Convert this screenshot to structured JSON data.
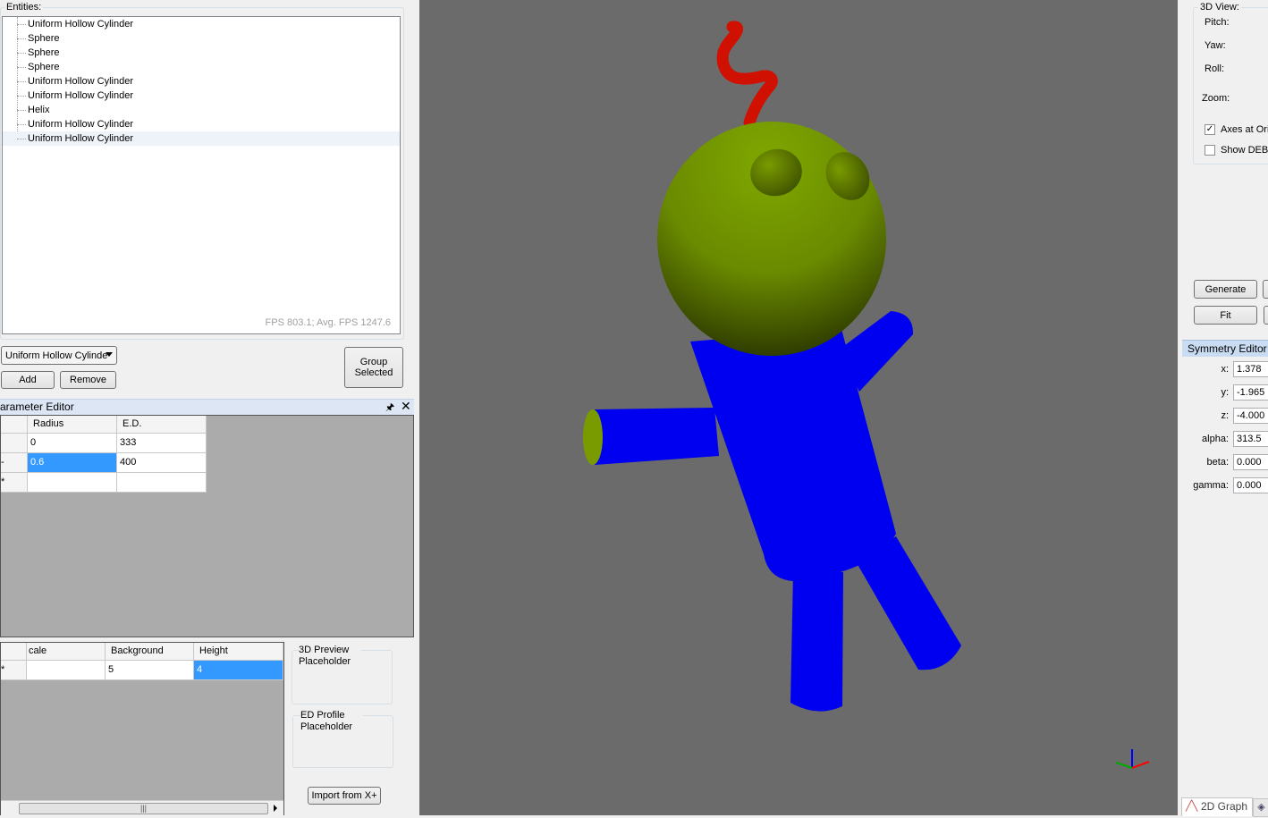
{
  "entities": {
    "label": "Entities:",
    "items": [
      "Uniform Hollow Cylinder",
      "Sphere",
      "Sphere",
      "Sphere",
      "Uniform Hollow Cylinder",
      "Uniform Hollow Cylinder",
      "Helix",
      "Uniform Hollow Cylinder",
      "Uniform Hollow Cylinder"
    ],
    "fps": "FPS 803.1; Avg. FPS 1247.6"
  },
  "toolbar": {
    "type_dropdown": "Uniform Hollow Cylinde",
    "add": "Add",
    "remove": "Remove",
    "group_selected": "Group Selected"
  },
  "parameter_editor": {
    "title": "arameter Editor",
    "columns": [
      "Radius",
      "E.D."
    ],
    "rows": [
      {
        "marker": "",
        "radius": "0",
        "ed": "333"
      },
      {
        "marker": "-",
        "radius": "0.6",
        "ed": "400"
      },
      {
        "marker": "*",
        "radius": "",
        "ed": ""
      }
    ]
  },
  "lower_grid": {
    "columns": [
      "cale",
      "Background",
      "Height"
    ],
    "row": {
      "marker": "*",
      "scale": "",
      "background": "5",
      "height": "4"
    }
  },
  "previews": {
    "preview_3d": "3D Preview Placeholder",
    "ed_profile": "ED Profile Placeholder",
    "import": "Import from X+"
  },
  "view3d_settings": {
    "title": "3D View:",
    "pitch": "Pitch:",
    "yaw": "Yaw:",
    "roll": "Roll:",
    "zoom": "Zoom:",
    "axes_checkbox": "Axes at Ori",
    "axes_checked": true,
    "debug_checkbox": "Show DEB",
    "debug_checked": false,
    "generate": "Generate",
    "fit": "Fit"
  },
  "symmetry_editor": {
    "title": "Symmetry Editor",
    "fields": [
      {
        "label": "x:",
        "value": "1.378"
      },
      {
        "label": "y:",
        "value": "-1.965"
      },
      {
        "label": "z:",
        "value": "-4.000"
      },
      {
        "label": "alpha:",
        "value": "313.5"
      },
      {
        "label": "beta:",
        "value": "0.000"
      },
      {
        "label": "gamma:",
        "value": "0.000"
      }
    ]
  },
  "bottom_tab": "2D Graph",
  "colors": {
    "viewport_bg": "#6b6b6b",
    "head": "#7a9b00",
    "body": "#0000f0",
    "helix": "#d01000",
    "selection": "#3399ff"
  }
}
